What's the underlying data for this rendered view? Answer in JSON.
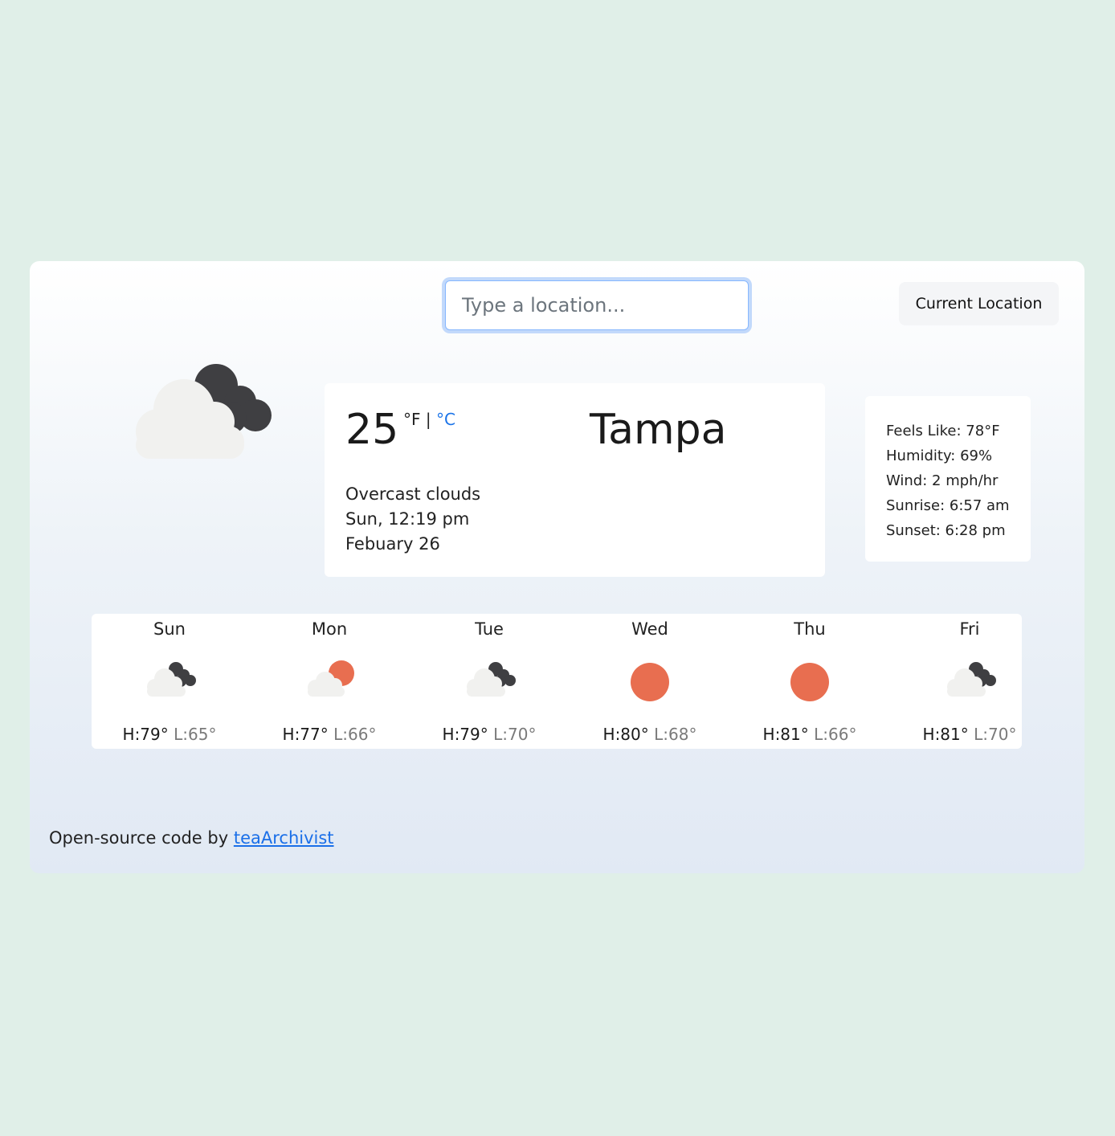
{
  "search": {
    "placeholder": "Type a location..."
  },
  "header": {
    "current_location_label": "Current Location"
  },
  "current": {
    "icon": "overcast-clouds-icon",
    "temperature": "25",
    "unit_f": "°F",
    "unit_separator": "|",
    "unit_c": "°C",
    "city": "Tampa",
    "description": "Overcast clouds",
    "day_time": "Sun, 12:19 pm",
    "date": "Febuary 26"
  },
  "details": {
    "feels_like": "Feels Like: 78°F",
    "humidity": "Humidity: 69%",
    "wind": "Wind: 2 mph/hr",
    "sunrise": "Sunrise: 6:57 am",
    "sunset": "Sunset: 6:28 pm"
  },
  "forecast": [
    {
      "day": "Sun",
      "icon": "overcast-clouds-icon",
      "high": "H:79°",
      "low": "L:65°"
    },
    {
      "day": "Mon",
      "icon": "partly-cloudy-icon",
      "high": "H:77°",
      "low": "L:66°"
    },
    {
      "day": "Tue",
      "icon": "overcast-clouds-icon",
      "high": "H:79°",
      "low": "L:70°"
    },
    {
      "day": "Wed",
      "icon": "sun-icon",
      "high": "H:80°",
      "low": "L:68°"
    },
    {
      "day": "Thu",
      "icon": "sun-icon",
      "high": "H:81°",
      "low": "L:66°"
    },
    {
      "day": "Fri",
      "icon": "overcast-clouds-icon",
      "high": "H:81°",
      "low": "L:70°"
    }
  ],
  "footer": {
    "text": "Open-source code by ",
    "link_label": "teaArchivist"
  },
  "colors": {
    "sun": "#e86e50",
    "dark_cloud": "#3f3f42",
    "light_cloud": "#f1f1ef",
    "link": "#1a6fe8"
  }
}
